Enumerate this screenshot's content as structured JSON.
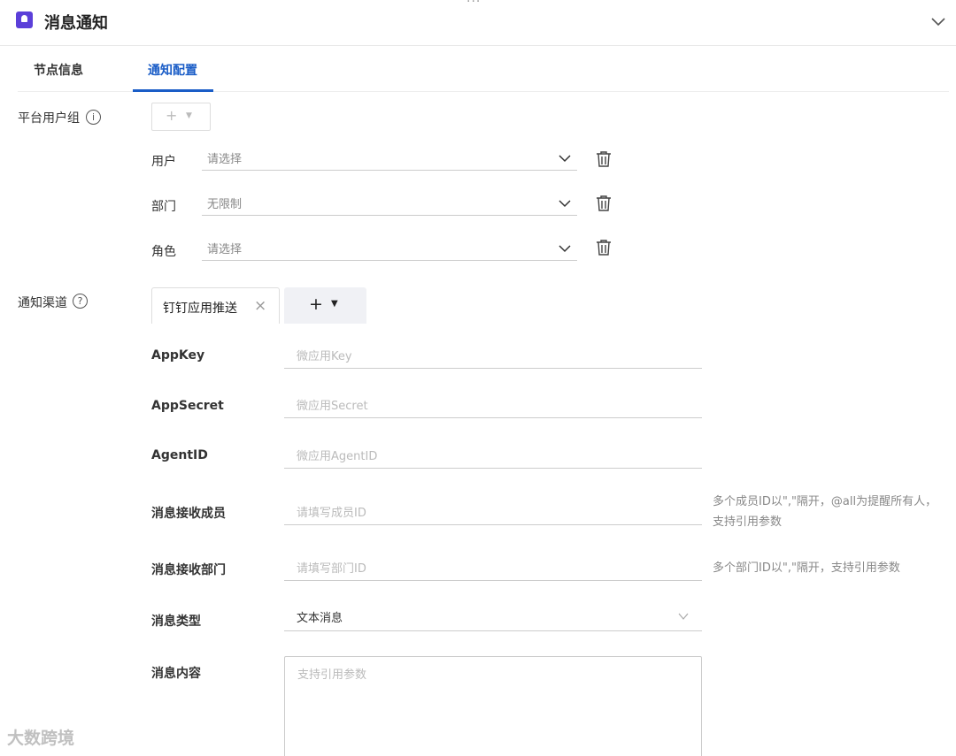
{
  "window": {
    "dots": "···",
    "title": "消息通知"
  },
  "tabs": [
    {
      "label": "节点信息",
      "active": false
    },
    {
      "label": "通知配置",
      "active": true
    }
  ],
  "platform_group": {
    "label": "平台用户组",
    "info_icon": "info-circle-icon",
    "rows": [
      {
        "label": "用户",
        "value": "请选择"
      },
      {
        "label": "部门",
        "value": "无限制"
      },
      {
        "label": "角色",
        "value": "请选择"
      }
    ]
  },
  "channel": {
    "label": "通知渠道",
    "help_icon": "question-circle-icon",
    "active_tab": "钉钉应用推送"
  },
  "form": {
    "appkey": {
      "label": "AppKey",
      "placeholder": "微应用Key"
    },
    "appsecret": {
      "label": "AppSecret",
      "placeholder": "微应用Secret"
    },
    "agentid": {
      "label": "AgentID",
      "placeholder": "微应用AgentID"
    },
    "members": {
      "label": "消息接收成员",
      "placeholder": "请填写成员ID",
      "help_line1": "多个成员ID以\",\"隔开，@all为提醒所有人，",
      "help_line2": "支持引用参数"
    },
    "depts": {
      "label": "消息接收部门",
      "placeholder": "请填写部门ID",
      "help": "多个部门ID以\",\"隔开，支持引用参数"
    },
    "msg_type": {
      "label": "消息类型",
      "value": "文本消息"
    },
    "content": {
      "label": "消息内容",
      "placeholder": "支持引用参数"
    }
  },
  "watermark": "大数跨境",
  "colors": {
    "accent": "#1a5dc7",
    "brand_icon": "#5b3fd9"
  }
}
